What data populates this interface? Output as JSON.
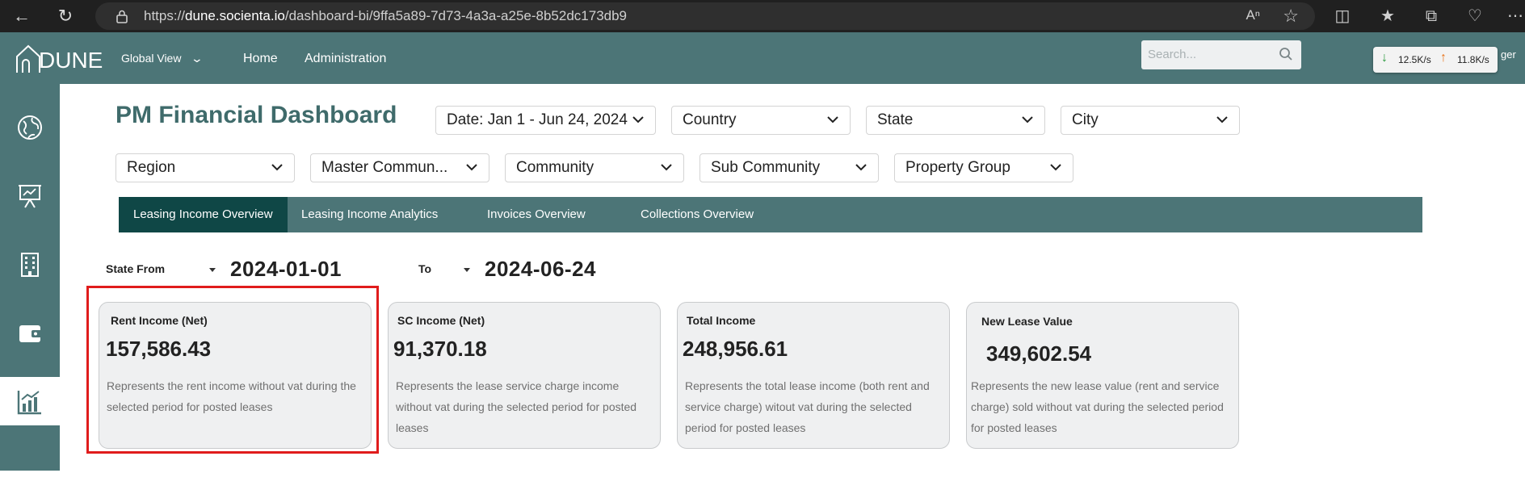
{
  "browser": {
    "url_host": "dune.socienta.io",
    "url_path": "/dashboard-bi/9ffa5a89-7d73-4a3a-a25e-8b52dc173db9",
    "url_scheme": "https://"
  },
  "app": {
    "logo_text": "DUNE",
    "global_view": "Global View",
    "nav": [
      "Home",
      "Administration"
    ],
    "search_placeholder": "Search...",
    "net_down": "12.5K/s",
    "net_up": "11.8K/s",
    "user_fragment": "ger"
  },
  "sidebar": {
    "items": [
      "globe-icon",
      "presentation-icon",
      "building-icon",
      "wallet-icon",
      "chart-icon"
    ],
    "active_index": 4
  },
  "dashboard": {
    "title": "PM Financial Dashboard",
    "filters_row1": [
      "Date: Jan 1 - Jun 24, 2024",
      "Country",
      "State",
      "City"
    ],
    "filters_row2": [
      "Region",
      "Master Commun...",
      "Community",
      "Sub Community",
      "Property Group"
    ],
    "tabs": [
      "Leasing Income Overview",
      "Leasing Income Analytics",
      "Invoices Overview",
      "Collections Overview"
    ],
    "active_tab": 0,
    "state_from_label": "State From",
    "state_from_value": "2024-01-01",
    "to_label": "To",
    "to_value": "2024-06-24",
    "cards": [
      {
        "title": "Rent Income (Net)",
        "value": "157,586.43",
        "desc": "Represents the rent income without vat during the selected period for posted leases"
      },
      {
        "title": "SC Income (Net)",
        "value": "91,370.18",
        "desc": "Represents the lease service charge income without vat during the selected period for posted leases"
      },
      {
        "title": "Total Income",
        "value": "248,956.61",
        "desc": "Represents the total lease income (both rent and service charge) witout vat during the selected period for posted leases"
      },
      {
        "title": "New Lease Value",
        "value": "349,602.54",
        "desc": "Represents the new lease value (rent and service charge) sold without vat during the selected period for posted leases"
      }
    ],
    "highlight_color": "#e01c1c"
  }
}
